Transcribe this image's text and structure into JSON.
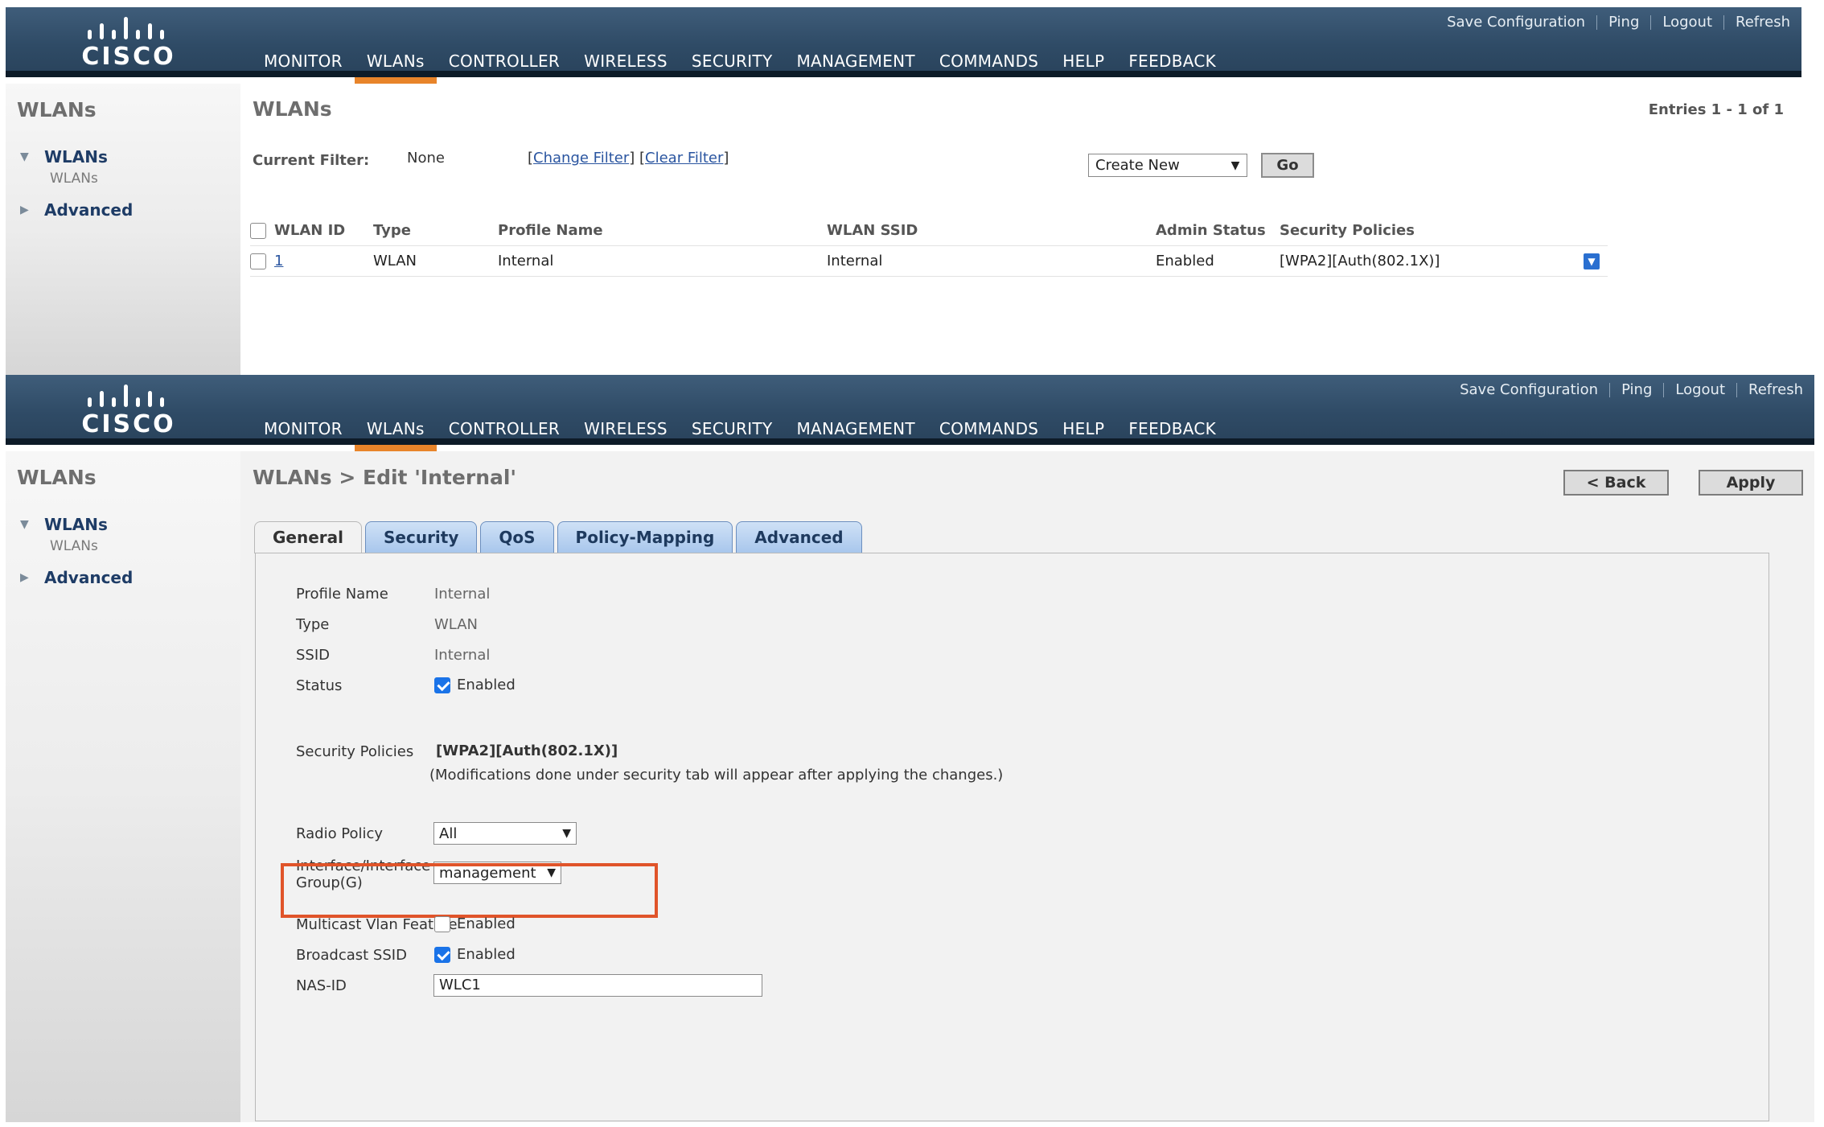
{
  "brand": "CISCO",
  "utility_links": [
    "Save Configuration",
    "Ping",
    "Logout",
    "Refresh"
  ],
  "menu": [
    "MONITOR",
    "WLANs",
    "CONTROLLER",
    "WIRELESS",
    "SECURITY",
    "MANAGEMENT",
    "COMMANDS",
    "HELP",
    "FEEDBACK"
  ],
  "menu_active": "WLANs",
  "sidebar": {
    "title": "WLANs",
    "items": [
      {
        "label": "WLANs",
        "expanded": true,
        "sub": "WLANs"
      },
      {
        "label": "Advanced",
        "expanded": false
      }
    ]
  },
  "list_page": {
    "title": "WLANs",
    "entries": "Entries 1 - 1 of 1",
    "filter_label": "Current Filter:",
    "filter_value": "None",
    "change_filter": "Change Filter",
    "clear_filter": "Clear Filter",
    "action_select": "Create New",
    "go_label": "Go",
    "columns": [
      "WLAN ID",
      "Type",
      "Profile Name",
      "WLAN SSID",
      "Admin Status",
      "Security Policies"
    ],
    "rows": [
      {
        "id": "1",
        "type": "WLAN",
        "profile": "Internal",
        "ssid": "Internal",
        "admin_status": "Enabled",
        "security": "[WPA2][Auth(802.1X)]"
      }
    ]
  },
  "edit_page": {
    "title": "WLANs > Edit  'Internal'",
    "back_label": "< Back",
    "apply_label": "Apply",
    "tabs": [
      "General",
      "Security",
      "QoS",
      "Policy-Mapping",
      "Advanced"
    ],
    "active_tab": "General",
    "fields": {
      "profile_name": {
        "label": "Profile Name",
        "value": "Internal"
      },
      "type": {
        "label": "Type",
        "value": "WLAN"
      },
      "ssid": {
        "label": "SSID",
        "value": "Internal"
      },
      "status": {
        "label": "Status",
        "checked": true,
        "text": "Enabled"
      },
      "security_policies": {
        "label": "Security Policies",
        "value": "[WPA2][Auth(802.1X)]",
        "note": "(Modifications done under security tab will appear after applying the changes.)"
      },
      "radio_policy": {
        "label": "Radio Policy",
        "value": "All"
      },
      "interface": {
        "label_line1": "Interface/Interface",
        "label_line2": "Group(G)",
        "value": "management"
      },
      "multicast_vlan": {
        "label": "Multicast Vlan Feature",
        "checked": false,
        "text": "Enabled"
      },
      "broadcast_ssid": {
        "label": "Broadcast SSID",
        "checked": true,
        "text": "Enabled"
      },
      "nas_id": {
        "label": "NAS-ID",
        "value": "WLC1"
      }
    }
  },
  "colors": {
    "header": "#2f4b66",
    "active_underline": "#e8842a",
    "highlight_box": "#e0542a",
    "link": "#2a55a0"
  }
}
